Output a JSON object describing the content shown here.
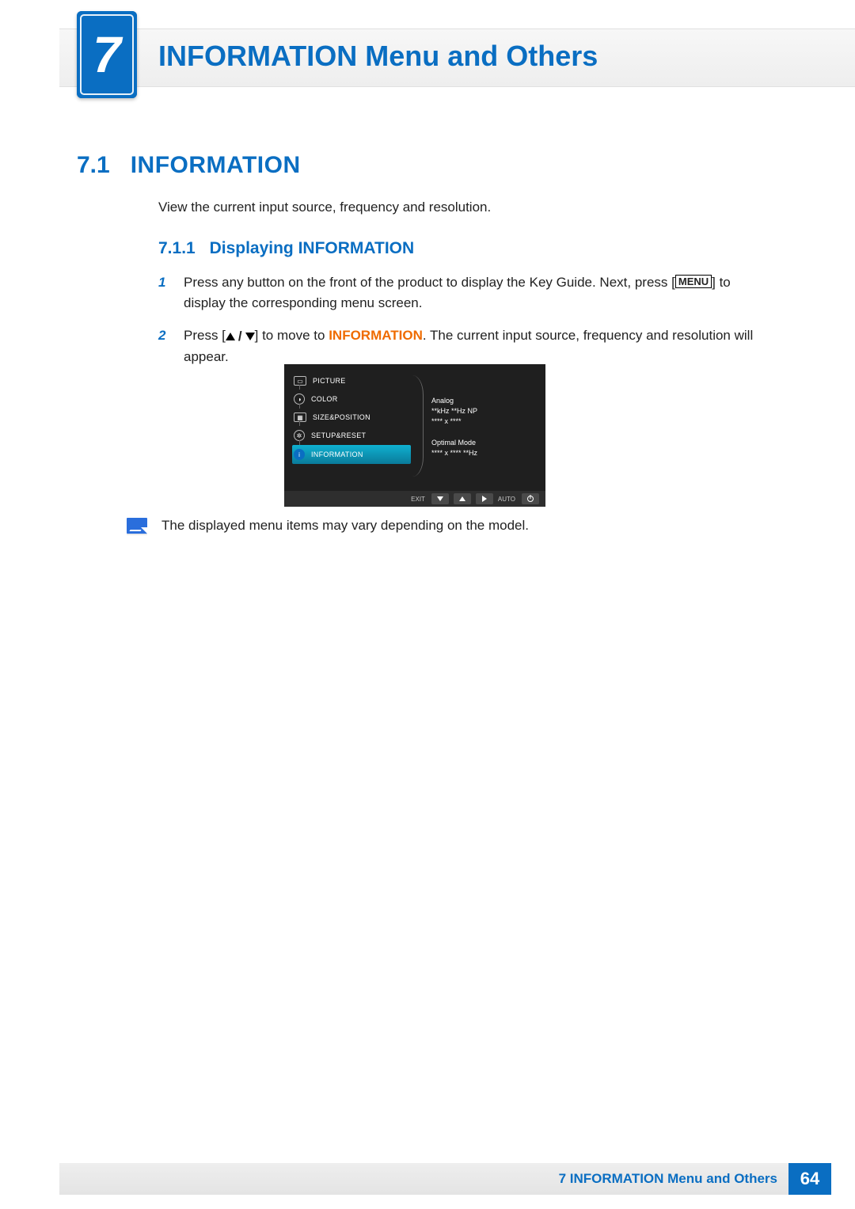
{
  "header": {
    "chapter_number": "7",
    "chapter_title": "INFORMATION Menu and Others"
  },
  "section": {
    "number": "7.1",
    "title": "INFORMATION",
    "intro": "View the current input source, frequency and resolution."
  },
  "subsection": {
    "number": "7.1.1",
    "title": "Displaying INFORMATION"
  },
  "steps": {
    "s1": {
      "num": "1",
      "pre": "Press any button on the front of the product to display the Key Guide. Next, press [",
      "menu": "MENU",
      "post": "] to display the corresponding menu screen."
    },
    "s2": {
      "num": "2",
      "pre": "Press [",
      "mid": "] to move to ",
      "kw": "INFORMATION",
      "post": ". The current input source, frequency and resolution will appear."
    }
  },
  "osd": {
    "menu": {
      "picture": "PICTURE",
      "color": "COLOR",
      "sizepos": "SIZE&POSITION",
      "setup": "SETUP&RESET",
      "info": "INFORMATION"
    },
    "info": {
      "l1": "Analog",
      "l2": "**kHz  **Hz  NP",
      "l3": "****  x  ****",
      "l4": "Optimal Mode",
      "l5": "****  x  ****   **Hz"
    },
    "footer": {
      "exit": "EXIT",
      "auto": "AUTO"
    }
  },
  "note": "The displayed menu items may vary depending on the model.",
  "footer": {
    "label": "7 INFORMATION Menu and Others",
    "page": "64"
  }
}
